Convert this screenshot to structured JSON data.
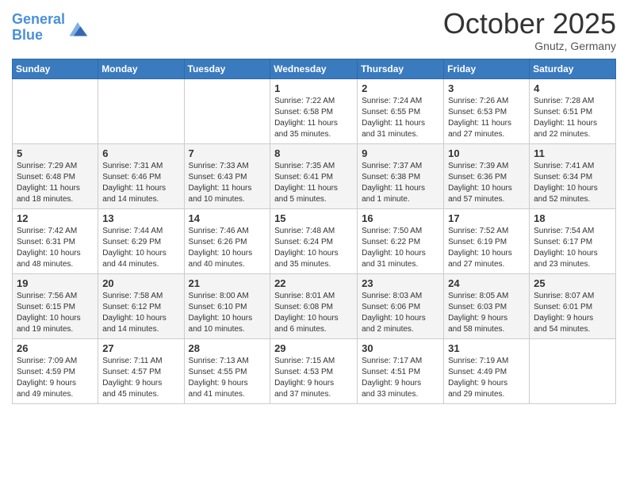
{
  "logo": {
    "line1": "General",
    "line2": "Blue"
  },
  "title": "October 2025",
  "subtitle": "Gnutz, Germany",
  "days_header": [
    "Sunday",
    "Monday",
    "Tuesday",
    "Wednesday",
    "Thursday",
    "Friday",
    "Saturday"
  ],
  "weeks": [
    [
      {
        "day": "",
        "info": ""
      },
      {
        "day": "",
        "info": ""
      },
      {
        "day": "",
        "info": ""
      },
      {
        "day": "1",
        "info": "Sunrise: 7:22 AM\nSunset: 6:58 PM\nDaylight: 11 hours\nand 35 minutes."
      },
      {
        "day": "2",
        "info": "Sunrise: 7:24 AM\nSunset: 6:55 PM\nDaylight: 11 hours\nand 31 minutes."
      },
      {
        "day": "3",
        "info": "Sunrise: 7:26 AM\nSunset: 6:53 PM\nDaylight: 11 hours\nand 27 minutes."
      },
      {
        "day": "4",
        "info": "Sunrise: 7:28 AM\nSunset: 6:51 PM\nDaylight: 11 hours\nand 22 minutes."
      }
    ],
    [
      {
        "day": "5",
        "info": "Sunrise: 7:29 AM\nSunset: 6:48 PM\nDaylight: 11 hours\nand 18 minutes."
      },
      {
        "day": "6",
        "info": "Sunrise: 7:31 AM\nSunset: 6:46 PM\nDaylight: 11 hours\nand 14 minutes."
      },
      {
        "day": "7",
        "info": "Sunrise: 7:33 AM\nSunset: 6:43 PM\nDaylight: 11 hours\nand 10 minutes."
      },
      {
        "day": "8",
        "info": "Sunrise: 7:35 AM\nSunset: 6:41 PM\nDaylight: 11 hours\nand 5 minutes."
      },
      {
        "day": "9",
        "info": "Sunrise: 7:37 AM\nSunset: 6:38 PM\nDaylight: 11 hours\nand 1 minute."
      },
      {
        "day": "10",
        "info": "Sunrise: 7:39 AM\nSunset: 6:36 PM\nDaylight: 10 hours\nand 57 minutes."
      },
      {
        "day": "11",
        "info": "Sunrise: 7:41 AM\nSunset: 6:34 PM\nDaylight: 10 hours\nand 52 minutes."
      }
    ],
    [
      {
        "day": "12",
        "info": "Sunrise: 7:42 AM\nSunset: 6:31 PM\nDaylight: 10 hours\nand 48 minutes."
      },
      {
        "day": "13",
        "info": "Sunrise: 7:44 AM\nSunset: 6:29 PM\nDaylight: 10 hours\nand 44 minutes."
      },
      {
        "day": "14",
        "info": "Sunrise: 7:46 AM\nSunset: 6:26 PM\nDaylight: 10 hours\nand 40 minutes."
      },
      {
        "day": "15",
        "info": "Sunrise: 7:48 AM\nSunset: 6:24 PM\nDaylight: 10 hours\nand 35 minutes."
      },
      {
        "day": "16",
        "info": "Sunrise: 7:50 AM\nSunset: 6:22 PM\nDaylight: 10 hours\nand 31 minutes."
      },
      {
        "day": "17",
        "info": "Sunrise: 7:52 AM\nSunset: 6:19 PM\nDaylight: 10 hours\nand 27 minutes."
      },
      {
        "day": "18",
        "info": "Sunrise: 7:54 AM\nSunset: 6:17 PM\nDaylight: 10 hours\nand 23 minutes."
      }
    ],
    [
      {
        "day": "19",
        "info": "Sunrise: 7:56 AM\nSunset: 6:15 PM\nDaylight: 10 hours\nand 19 minutes."
      },
      {
        "day": "20",
        "info": "Sunrise: 7:58 AM\nSunset: 6:12 PM\nDaylight: 10 hours\nand 14 minutes."
      },
      {
        "day": "21",
        "info": "Sunrise: 8:00 AM\nSunset: 6:10 PM\nDaylight: 10 hours\nand 10 minutes."
      },
      {
        "day": "22",
        "info": "Sunrise: 8:01 AM\nSunset: 6:08 PM\nDaylight: 10 hours\nand 6 minutes."
      },
      {
        "day": "23",
        "info": "Sunrise: 8:03 AM\nSunset: 6:06 PM\nDaylight: 10 hours\nand 2 minutes."
      },
      {
        "day": "24",
        "info": "Sunrise: 8:05 AM\nSunset: 6:03 PM\nDaylight: 9 hours\nand 58 minutes."
      },
      {
        "day": "25",
        "info": "Sunrise: 8:07 AM\nSunset: 6:01 PM\nDaylight: 9 hours\nand 54 minutes."
      }
    ],
    [
      {
        "day": "26",
        "info": "Sunrise: 7:09 AM\nSunset: 4:59 PM\nDaylight: 9 hours\nand 49 minutes."
      },
      {
        "day": "27",
        "info": "Sunrise: 7:11 AM\nSunset: 4:57 PM\nDaylight: 9 hours\nand 45 minutes."
      },
      {
        "day": "28",
        "info": "Sunrise: 7:13 AM\nSunset: 4:55 PM\nDaylight: 9 hours\nand 41 minutes."
      },
      {
        "day": "29",
        "info": "Sunrise: 7:15 AM\nSunset: 4:53 PM\nDaylight: 9 hours\nand 37 minutes."
      },
      {
        "day": "30",
        "info": "Sunrise: 7:17 AM\nSunset: 4:51 PM\nDaylight: 9 hours\nand 33 minutes."
      },
      {
        "day": "31",
        "info": "Sunrise: 7:19 AM\nSunset: 4:49 PM\nDaylight: 9 hours\nand 29 minutes."
      },
      {
        "day": "",
        "info": ""
      }
    ]
  ]
}
